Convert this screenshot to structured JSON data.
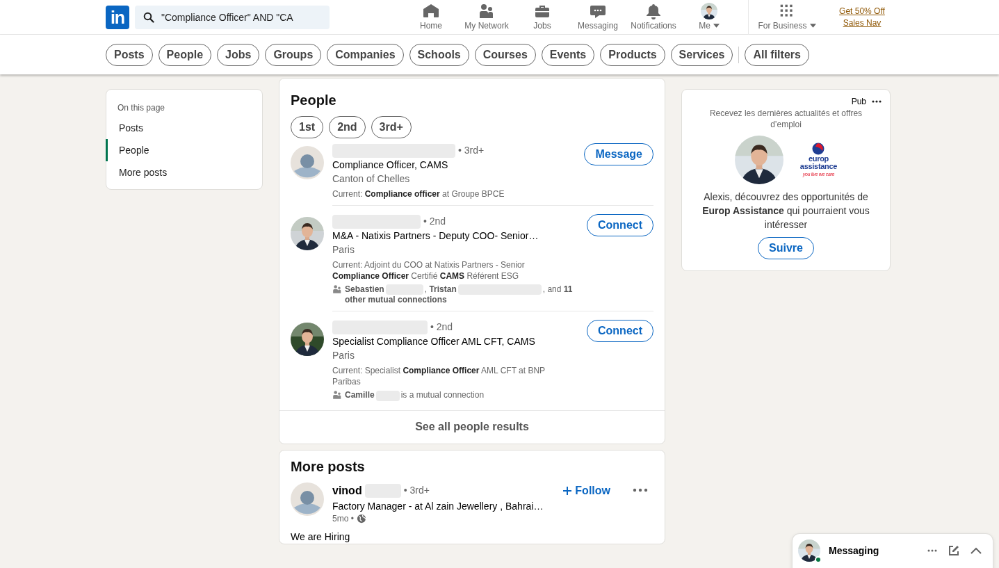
{
  "nav": {
    "logo": "in",
    "search": {
      "value": "\"Compliance Officer\" AND \"CA"
    },
    "items": [
      {
        "label": "Home"
      },
      {
        "label": "My Network"
      },
      {
        "label": "Jobs"
      },
      {
        "label": "Messaging"
      },
      {
        "label": "Notifications"
      }
    ],
    "me": {
      "label": "Me"
    },
    "business": {
      "label": "For Business"
    },
    "promo": "Get 50% Off Sales Nav"
  },
  "filters": [
    "Posts",
    "People",
    "Jobs",
    "Groups",
    "Companies",
    "Schools",
    "Courses",
    "Events",
    "Products",
    "Services"
  ],
  "all_filters": "All filters",
  "sidebar": {
    "title": "On this page",
    "items": [
      {
        "label": "Posts",
        "selected": false
      },
      {
        "label": "People",
        "selected": true
      },
      {
        "label": "More posts",
        "selected": false
      }
    ]
  },
  "people": {
    "title": "People",
    "degree_filters": [
      "1st",
      "2nd",
      "3rd+"
    ],
    "results": [
      {
        "has_photo": false,
        "degree": "• 3rd+",
        "headline": "Compliance Officer, CAMS",
        "location": "Canton of Chelles",
        "current": "Current: **Compliance officer** at Groupe BPCE",
        "action": "Message"
      },
      {
        "has_photo": true,
        "degree": "• 2nd",
        "headline": "M&A - Natixis Partners - Deputy COO- Senior…",
        "location": "Paris",
        "current": "Current: Adjoint du COO at Natixis Partners - Senior **Compliance Officer** Certifié **CAMS** Référent ESG",
        "mutual": [
          "**Sebastien**",
          ", **Tristan**",
          ", and **11 other mutual connections**"
        ],
        "action": "Connect"
      },
      {
        "has_photo": true,
        "degree": "• 2nd",
        "headline": "Specialist Compliance Officer AML CFT, CAMS",
        "location": "Paris",
        "current": "Current: Specialist **Compliance Officer** AML CFT at BNP Paribas",
        "mutual": [
          "**Camille**",
          "is a mutual connection"
        ],
        "action": "Connect"
      }
    ],
    "see_all": "See all people results"
  },
  "ad": {
    "label": "Pub",
    "header": "Recevez les dernières actualités et offres d’emploi",
    "logo": [
      "europ",
      "assistance",
      "you live we care"
    ],
    "body": "Alexis, découvrez des opportunités de **Europ Assistance** qui pourraient vous intéresser",
    "button": "Suivre"
  },
  "more_posts": {
    "title": "More posts",
    "post": {
      "author": "vinod",
      "degree": "• 3rd+",
      "headline": "Factory Manager - at Al zain Jewellery , Bahrai…",
      "age": "5mo •",
      "follow": "Follow",
      "text": "We are Hiring"
    }
  },
  "messaging": {
    "label": "Messaging",
    "online": true
  }
}
